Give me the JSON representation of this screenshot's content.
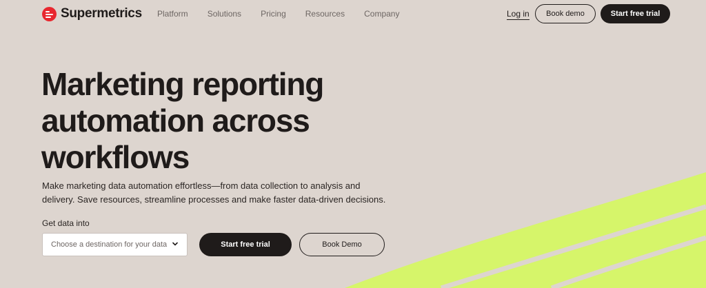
{
  "brand": {
    "name": "Supermetrics",
    "logo_color": "#e8272f"
  },
  "nav": {
    "items": [
      {
        "label": "Platform"
      },
      {
        "label": "Solutions"
      },
      {
        "label": "Pricing"
      },
      {
        "label": "Resources"
      },
      {
        "label": "Company"
      }
    ]
  },
  "header_actions": {
    "login": "Log in",
    "book_demo": "Book demo",
    "start_trial": "Start free trial"
  },
  "hero": {
    "title": "Marketing reporting automation across workflows",
    "subtitle": "Make marketing data automation effortless—from data collection to analysis and delivery. Save resources, streamline processes and make faster data-driven decisions.",
    "get_data_label": "Get data into",
    "destination_placeholder": "Choose a destination for your data",
    "cta_primary": "Start free trial",
    "cta_secondary": "Book Demo"
  },
  "colors": {
    "background": "#ddd5cf",
    "text": "#1f1b1a",
    "accent_wave": "#d6f56a"
  },
  "icons": {
    "select_chevron": "chevron-down-icon"
  }
}
